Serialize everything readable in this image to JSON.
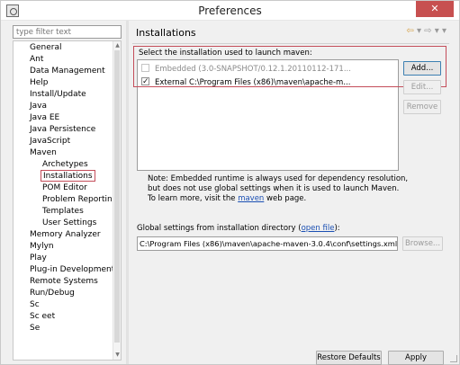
{
  "window": {
    "title": "Preferences",
    "close_label": "✕"
  },
  "filter": {
    "placeholder": "type filter text"
  },
  "tree": {
    "items": [
      {
        "label": "General"
      },
      {
        "label": "Ant"
      },
      {
        "label": "Data Management"
      },
      {
        "label": "Help"
      },
      {
        "label": "Install/Update"
      },
      {
        "label": "Java"
      },
      {
        "label": "Java EE"
      },
      {
        "label": "Java Persistence"
      },
      {
        "label": "JavaScript"
      },
      {
        "label": "Maven"
      },
      {
        "label": "Archetypes"
      },
      {
        "label": "Installations"
      },
      {
        "label": "POM Editor"
      },
      {
        "label": "Problem Reporting"
      },
      {
        "label": "Templates"
      },
      {
        "label": "User Settings"
      },
      {
        "label": "Memory Analyzer"
      },
      {
        "label": "Mylyn"
      },
      {
        "label": "Play"
      },
      {
        "label": "Plug-in Development"
      },
      {
        "label": "Remote Systems"
      },
      {
        "label": "Run/Debug"
      },
      {
        "label": "Sc"
      },
      {
        "label": "Sc          eet"
      },
      {
        "label": "Se"
      }
    ]
  },
  "page": {
    "title": "Installations",
    "nav_back": "⇦",
    "nav_forward": "⇨",
    "nav_menu": "▾",
    "section_label": "Select the installation used to launch maven:",
    "installations": [
      {
        "label": "Embedded (3.0-SNAPSHOT/0.12.1.20110112-171...",
        "checked": false,
        "enabled": false
      },
      {
        "label": "External C:\\Program Files (x86)\\maven\\apache-m...",
        "checked": true,
        "enabled": true
      }
    ],
    "buttons": {
      "add": "Add...",
      "edit": "Edit...",
      "remove": "Remove"
    },
    "note_part1": "Note: Embedded runtime is always used for dependency resolution, but does not use global settings when it is used to launch Maven. To learn more, visit the ",
    "note_link": "maven",
    "note_part2": " web page.",
    "global_label_part1": "Global settings from installation directory (",
    "global_label_link": "open file",
    "global_label_part2": "):",
    "global_value": "C:\\Program Files (x86)\\maven\\apache-maven-3.0.4\\conf\\settings.xml",
    "browse": "Browse...",
    "restore_defaults": "Restore Defaults",
    "apply": "Apply"
  },
  "colors": {
    "highlight": "#c44d5a",
    "close_button": "#c75050",
    "link": "#1a4fb3"
  }
}
